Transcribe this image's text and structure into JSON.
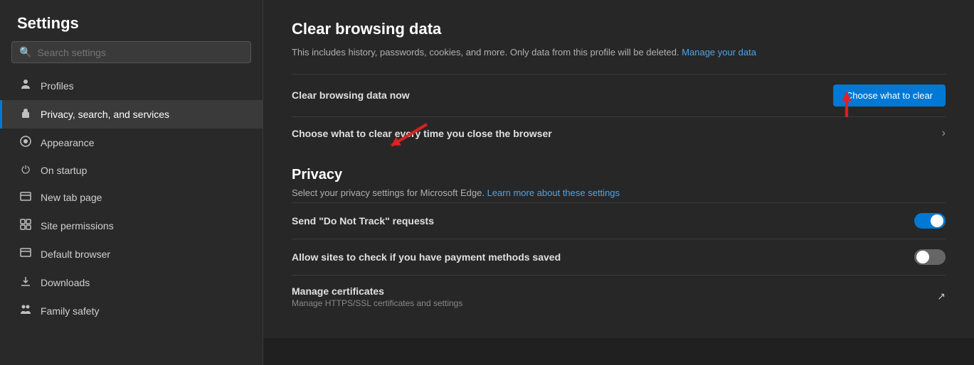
{
  "sidebar": {
    "title": "Settings",
    "search": {
      "placeholder": "Search settings",
      "value": ""
    },
    "items": [
      {
        "id": "profiles",
        "label": "Profiles",
        "icon": "👤",
        "active": false
      },
      {
        "id": "privacy",
        "label": "Privacy, search, and services",
        "icon": "🔒",
        "active": true
      },
      {
        "id": "appearance",
        "label": "Appearance",
        "icon": "🎨",
        "active": false
      },
      {
        "id": "on-startup",
        "label": "On startup",
        "icon": "⏻",
        "active": false
      },
      {
        "id": "new-tab",
        "label": "New tab page",
        "icon": "⊞",
        "active": false
      },
      {
        "id": "site-permissions",
        "label": "Site permissions",
        "icon": "⊟",
        "active": false
      },
      {
        "id": "default-browser",
        "label": "Default browser",
        "icon": "🖥",
        "active": false
      },
      {
        "id": "downloads",
        "label": "Downloads",
        "icon": "⬇",
        "active": false
      },
      {
        "id": "family-safety",
        "label": "Family safety",
        "icon": "👥",
        "active": false
      }
    ]
  },
  "main": {
    "clear_browsing": {
      "title": "Clear browsing data",
      "description": "This includes history, passwords, cookies, and more. Only data from this profile will be deleted.",
      "manage_link": "Manage your data",
      "clear_now_label": "Clear browsing data now",
      "choose_button": "Choose what to clear",
      "clear_every_time_label": "Choose what to clear every time you close the browser"
    },
    "privacy": {
      "title": "Privacy",
      "description": "Select your privacy settings for Microsoft Edge.",
      "learn_link": "Learn more about these settings",
      "do_not_track": {
        "label": "Send \"Do Not Track\" requests",
        "enabled": true
      },
      "payment_methods": {
        "label": "Allow sites to check if you have payment methods saved",
        "enabled": false
      },
      "manage_certificates": {
        "label": "Manage certificates",
        "sublabel": "Manage HTTPS/SSL certificates and settings"
      }
    }
  }
}
